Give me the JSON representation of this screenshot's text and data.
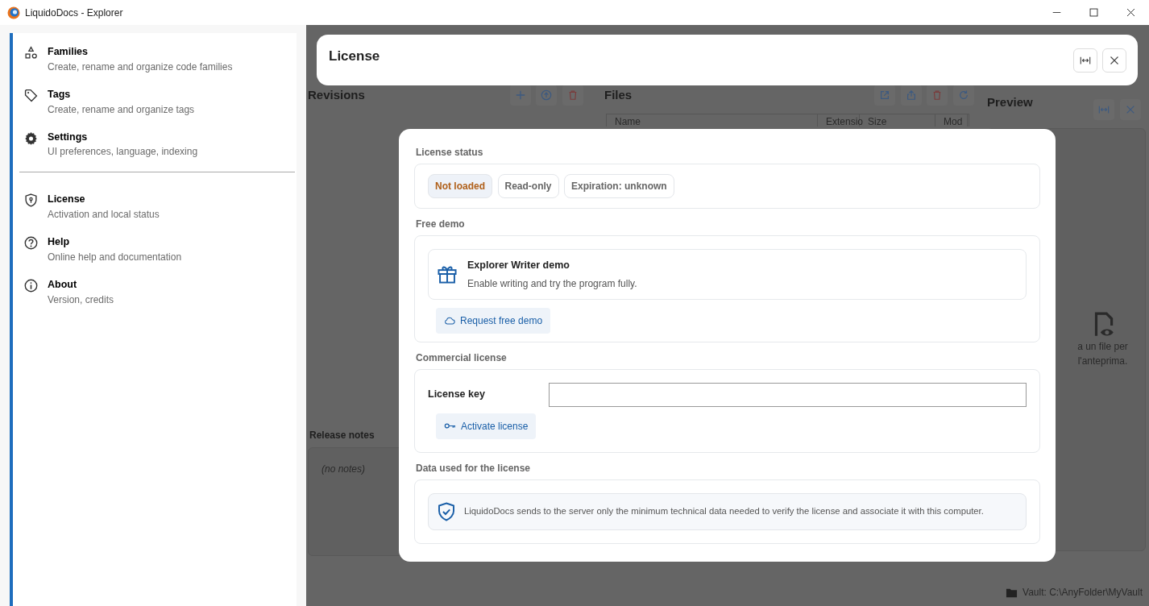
{
  "window": {
    "title": "LiquidoDocs - Explorer"
  },
  "sidebar": {
    "groups": [
      [
        {
          "title": "Families",
          "subtitle": "Create, rename and organize code families"
        },
        {
          "title": "Tags",
          "subtitle": "Create, rename and organize tags"
        },
        {
          "title": "Settings",
          "subtitle": "UI preferences, language, indexing"
        }
      ],
      [
        {
          "title": "License",
          "subtitle": "Activation and local status"
        },
        {
          "title": "Help",
          "subtitle": "Online help and documentation"
        },
        {
          "title": "About",
          "subtitle": "Version, credits"
        }
      ]
    ]
  },
  "background": {
    "revisions": {
      "title": "Revisions"
    },
    "files": {
      "title": "Files",
      "columns": [
        "Name",
        "Extensio",
        "Size",
        "Mod"
      ]
    },
    "preview": {
      "title": "Preview",
      "hint_lines": [
        "a un file per",
        "l'anteprima."
      ]
    },
    "release_notes": {
      "title": "Release notes",
      "empty": "(no notes)"
    }
  },
  "status_bar": {
    "vault": "Vault: C:\\AnyFolder\\MyVault"
  },
  "modal_header": {
    "title": "License"
  },
  "dialog": {
    "sections": [
      {
        "kind": "status",
        "heading": "License status",
        "badges": [
          {
            "label": "Not loaded",
            "color": "#b0601a"
          },
          {
            "label": "Read-only",
            "color": "#666666"
          },
          {
            "label": "Expiration: unknown",
            "color": "#666666"
          }
        ]
      },
      {
        "kind": "demo",
        "heading": "Free demo",
        "card_title": "Explorer Writer demo",
        "card_text": "Enable writing and try the program fully.",
        "button": "Request free demo"
      },
      {
        "kind": "key",
        "heading": "Commercial license",
        "label": "License key",
        "button": "Activate license"
      },
      {
        "kind": "info",
        "heading": "Data used for the license",
        "text": "LiquidoDocs sends to the server only the minimum technical data needed to verify the license and associate it with this computer."
      }
    ]
  }
}
